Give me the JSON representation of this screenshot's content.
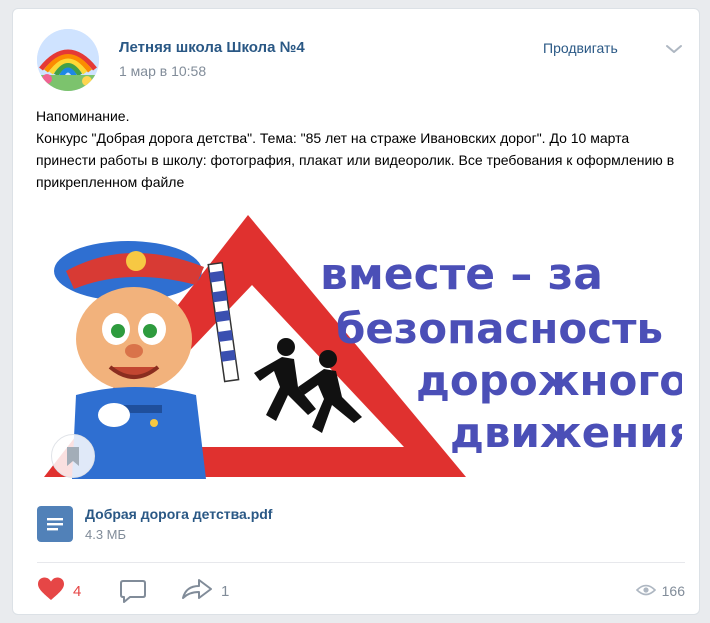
{
  "post": {
    "author": "Летняя школа Школа №4",
    "date": "1 мар в 10:58",
    "promote_label": "Продвигать",
    "text": "Напоминание.\nКонкурс \"Добрая дорога детства\". Тема: \"85 лет на страже Ивановских дорог\". До 10 марта принести работы в школу: фотография, плакат или видеоролик. Все требования к оформлению в прикрепленном файле"
  },
  "image": {
    "line1": "вместе – за",
    "line2": "безопасность",
    "line3": "дорожного",
    "line4": "движения"
  },
  "attachment": {
    "name": "Добрая дорога детства.pdf",
    "size": "4.3 МБ"
  },
  "footer": {
    "likes": "4",
    "shares": "1",
    "views": "166"
  },
  "icons": {
    "like": "heart-icon",
    "comment": "comment-icon",
    "share": "share-icon",
    "views": "eye-icon",
    "more": "chevron-down-icon",
    "doc": "document-icon",
    "bookmark": "bookmark-icon"
  },
  "colors": {
    "link": "#2a5885",
    "muted": "#818c99",
    "like": "#e64646",
    "sign_red": "#e0312f",
    "sign_text": "#4b4fb7"
  }
}
